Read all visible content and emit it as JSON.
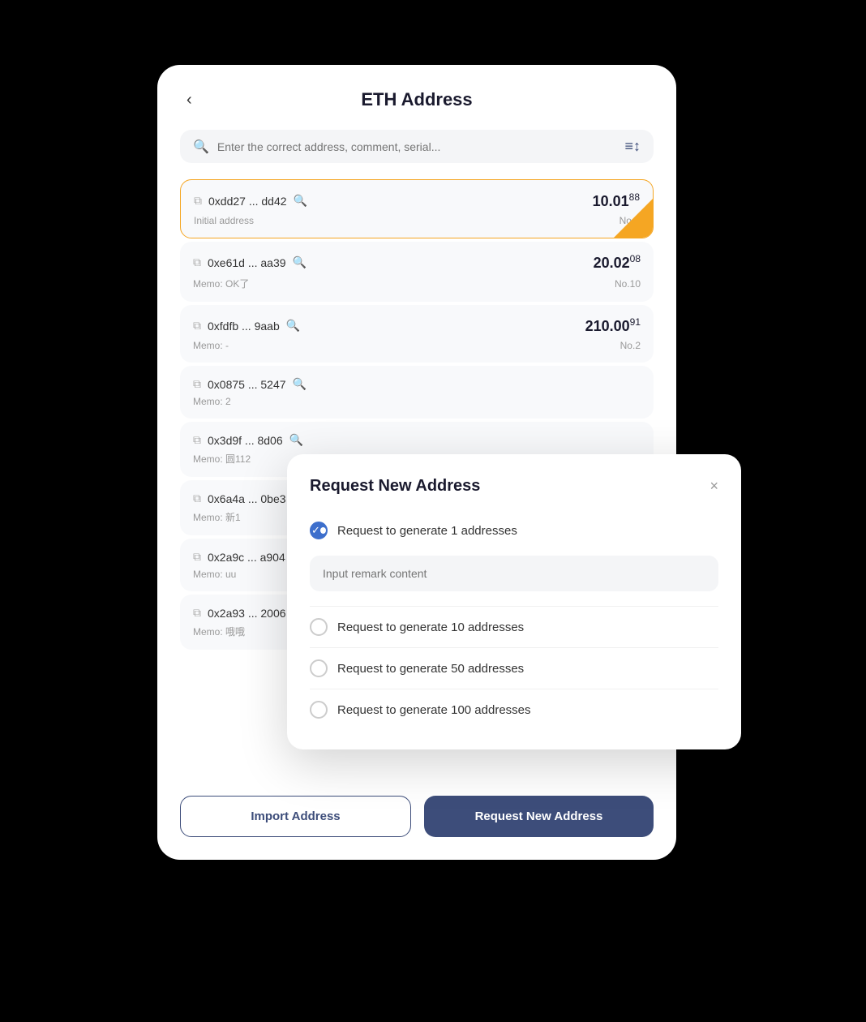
{
  "header": {
    "back_label": "‹",
    "title": "ETH Address"
  },
  "search": {
    "placeholder": "Enter the correct address, comment, serial...",
    "filter_icon": "≡↕"
  },
  "address_list": [
    {
      "id": "addr-1",
      "address": "0xdd27 ... dd42",
      "memo": "Initial address",
      "amount_main": "10.01",
      "amount_sup": "88",
      "no": "No.0",
      "active": true
    },
    {
      "id": "addr-2",
      "address": "0xe61d ... aa39",
      "memo": "Memo: OK了",
      "amount_main": "20.02",
      "amount_sup": "08",
      "no": "No.10",
      "active": false
    },
    {
      "id": "addr-3",
      "address": "0xfdfb ... 9aab",
      "memo": "Memo: -",
      "amount_main": "210.00",
      "amount_sup": "91",
      "no": "No.2",
      "active": false
    },
    {
      "id": "addr-4",
      "address": "0x0875 ... 5247",
      "memo": "Memo: 2",
      "amount_main": "",
      "amount_sup": "",
      "no": "",
      "active": false
    },
    {
      "id": "addr-5",
      "address": "0x3d9f ... 8d06",
      "memo": "Memo: 圆112",
      "amount_main": "",
      "amount_sup": "",
      "no": "",
      "active": false
    },
    {
      "id": "addr-6",
      "address": "0x6a4a ... 0be3",
      "memo": "Memo: 新1",
      "amount_main": "",
      "amount_sup": "",
      "no": "",
      "active": false
    },
    {
      "id": "addr-7",
      "address": "0x2a9c ... a904",
      "memo": "Memo: uu",
      "amount_main": "",
      "amount_sup": "",
      "no": "",
      "active": false
    },
    {
      "id": "addr-8",
      "address": "0x2a93 ... 2006",
      "memo": "Memo: 哦哦",
      "amount_main": "",
      "amount_sup": "",
      "no": "",
      "active": false
    }
  ],
  "footer": {
    "import_label": "Import Address",
    "request_label": "Request New Address"
  },
  "modal": {
    "title": "Request New Address",
    "close_label": "×",
    "remark_placeholder": "Input remark content",
    "options": [
      {
        "id": "opt-1",
        "label": "Request to generate 1 addresses",
        "checked": true
      },
      {
        "id": "opt-10",
        "label": "Request to generate 10 addresses",
        "checked": false
      },
      {
        "id": "opt-50",
        "label": "Request to generate 50 addresses",
        "checked": false
      },
      {
        "id": "opt-100",
        "label": "Request to generate 100 addresses",
        "checked": false
      }
    ]
  }
}
